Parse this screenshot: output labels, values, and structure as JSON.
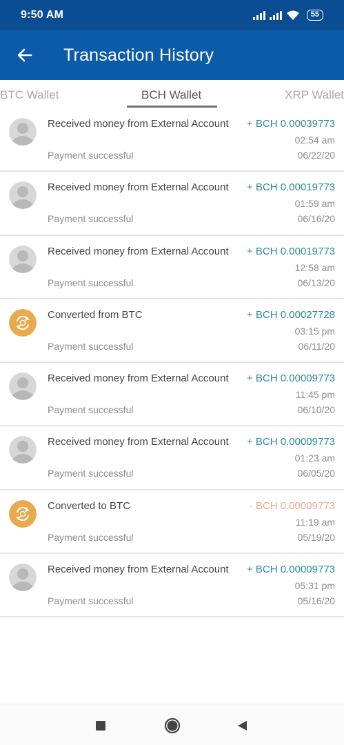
{
  "status_bar": {
    "time": "9:50 AM",
    "battery": "55",
    "icons": [
      "signal-icon",
      "signal-icon",
      "wifi-icon",
      "battery-icon"
    ]
  },
  "app_bar": {
    "title": "Transaction History",
    "back_icon": "arrow-left-icon"
  },
  "tabs": [
    {
      "label": "BTC Wallet",
      "active": false
    },
    {
      "label": "BCH Wallet",
      "active": true
    },
    {
      "label": "XRP Wallet",
      "active": false
    }
  ],
  "transactions": [
    {
      "icon": "user-avatar-icon",
      "title": "Received money from External Account",
      "amount": "+ BCH 0.00039773",
      "direction": "positive",
      "time": "02:54 am",
      "date": "06/22/20",
      "status": "Payment successful"
    },
    {
      "icon": "user-avatar-icon",
      "title": "Received money from External Account",
      "amount": "+ BCH 0.00019773",
      "direction": "positive",
      "time": "01:59 am",
      "date": "06/16/20",
      "status": "Payment successful"
    },
    {
      "icon": "user-avatar-icon",
      "title": "Received money from External Account",
      "amount": "+ BCH 0.00019773",
      "direction": "positive",
      "time": "12:58 am",
      "date": "06/13/20",
      "status": "Payment successful"
    },
    {
      "icon": "convert-icon",
      "title": "Converted from BTC",
      "amount": "+ BCH 0.00027728",
      "direction": "positive",
      "time": "03:15 pm",
      "date": "06/11/20",
      "status": "Payment successful"
    },
    {
      "icon": "user-avatar-icon",
      "title": "Received money from External Account",
      "amount": "+ BCH 0.00009773",
      "direction": "positive",
      "time": "11:45 pm",
      "date": "06/10/20",
      "status": "Payment successful"
    },
    {
      "icon": "user-avatar-icon",
      "title": "Received money from External Account",
      "amount": "+ BCH 0.00009773",
      "direction": "positive",
      "time": "01:23 am",
      "date": "06/05/20",
      "status": "Payment successful"
    },
    {
      "icon": "convert-icon",
      "title": "Converted to BTC",
      "amount": "- BCH 0.00009773",
      "direction": "negative",
      "time": "11:19 am",
      "date": "05/19/20",
      "status": "Payment successful"
    },
    {
      "icon": "user-avatar-icon",
      "title": "Received money from External Account",
      "amount": "+ BCH 0.00009773",
      "direction": "positive",
      "time": "05:31 pm",
      "date": "05/16/20",
      "status": "Payment successful"
    }
  ],
  "nav_bar": {
    "buttons": [
      "recents-icon",
      "home-icon",
      "back-triangle-icon"
    ]
  },
  "colors": {
    "status_bar": "#0a4d93",
    "app_bar": "#0b5ba8",
    "positive": "#2a8a9c",
    "negative": "#f0a88a",
    "convert_icon": "#e9a94c"
  }
}
